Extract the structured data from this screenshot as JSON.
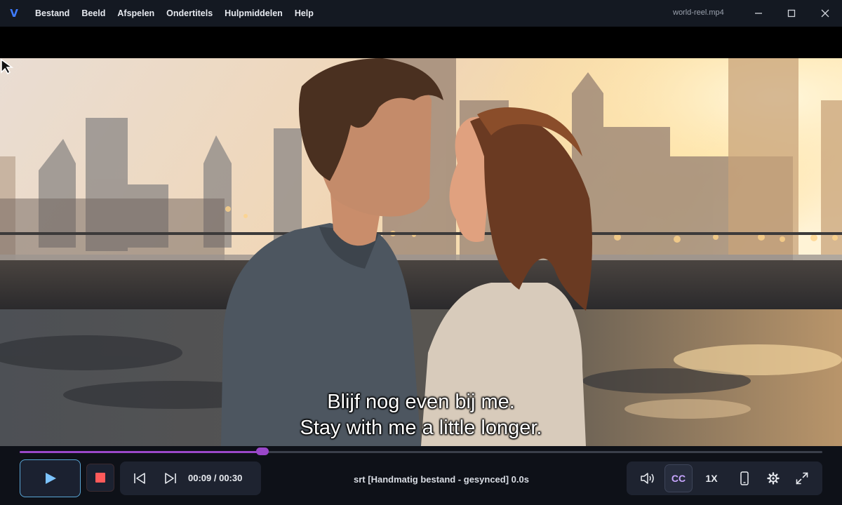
{
  "titlebar": {
    "logo": "V",
    "menu": [
      "Bestand",
      "Beeld",
      "Afspelen",
      "Ondertitels",
      "Hulpmiddelen",
      "Help"
    ],
    "filename": "world-reel.mp4"
  },
  "video": {
    "subtitle_line1": "Blijf nog even bij me.",
    "subtitle_line2": "Stay with me a little longer."
  },
  "playback": {
    "progress": 0.3,
    "current_time": "00:09",
    "total_time": "00:30",
    "timecode": "00:09 / 00:30"
  },
  "status": {
    "subtitle_info": "srt [Handmatig bestand - gesynced] 0.0s"
  },
  "controls": {
    "cc_label": "CC",
    "speed_label": "1X"
  },
  "colors": {
    "accent": "#9a47c9",
    "play_border": "#5aa6d6",
    "stop_icon": "#ff5a5a",
    "logo": "#3e7bff"
  }
}
